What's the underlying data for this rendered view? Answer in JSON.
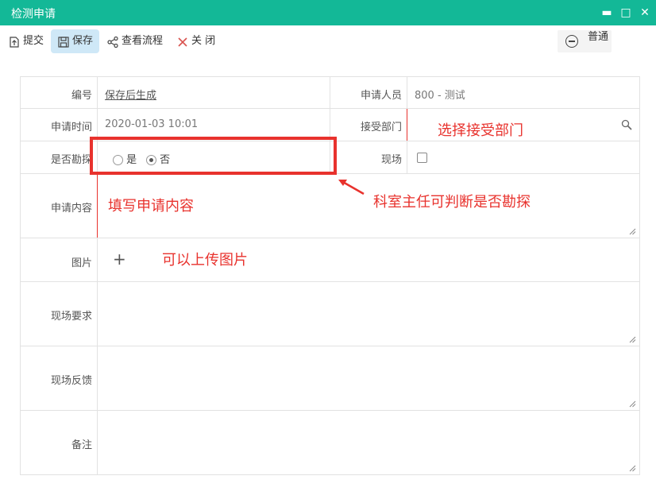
{
  "window": {
    "title": "检测申请",
    "minimize": "▬",
    "maximize": "□",
    "close": "✕"
  },
  "toolbar": {
    "submit_label": "提交",
    "save_label": "保存",
    "flow_label": "查看流程",
    "close_label": "关 闭",
    "priority_label": "普通"
  },
  "form": {
    "number_label": "编号",
    "number_value": "保存后生成",
    "applicant_label": "申请人员",
    "applicant_value": "800 - 测试",
    "time_label": "申请时间",
    "time_value": "2020-01-03 10:01",
    "dept_label": "接受部门",
    "survey_label": "是否勘探",
    "survey_options": [
      "是",
      "否"
    ],
    "survey_selected": "否",
    "onsite_label": "现场",
    "content_label": "申请内容",
    "image_label": "图片",
    "image_add": "+",
    "requirement_label": "现场要求",
    "feedback_label": "现场反馈",
    "remark_label": "备注"
  },
  "annotations": {
    "dept_hint": "选择接受部门",
    "survey_hint": "科室主任可判断是否勘探",
    "content_hint": "填写申请内容",
    "image_hint": "可以上传图片"
  },
  "colors": {
    "accent": "#13b897",
    "annotation": "#e8322d",
    "save_bg": "#cfe8f7"
  }
}
